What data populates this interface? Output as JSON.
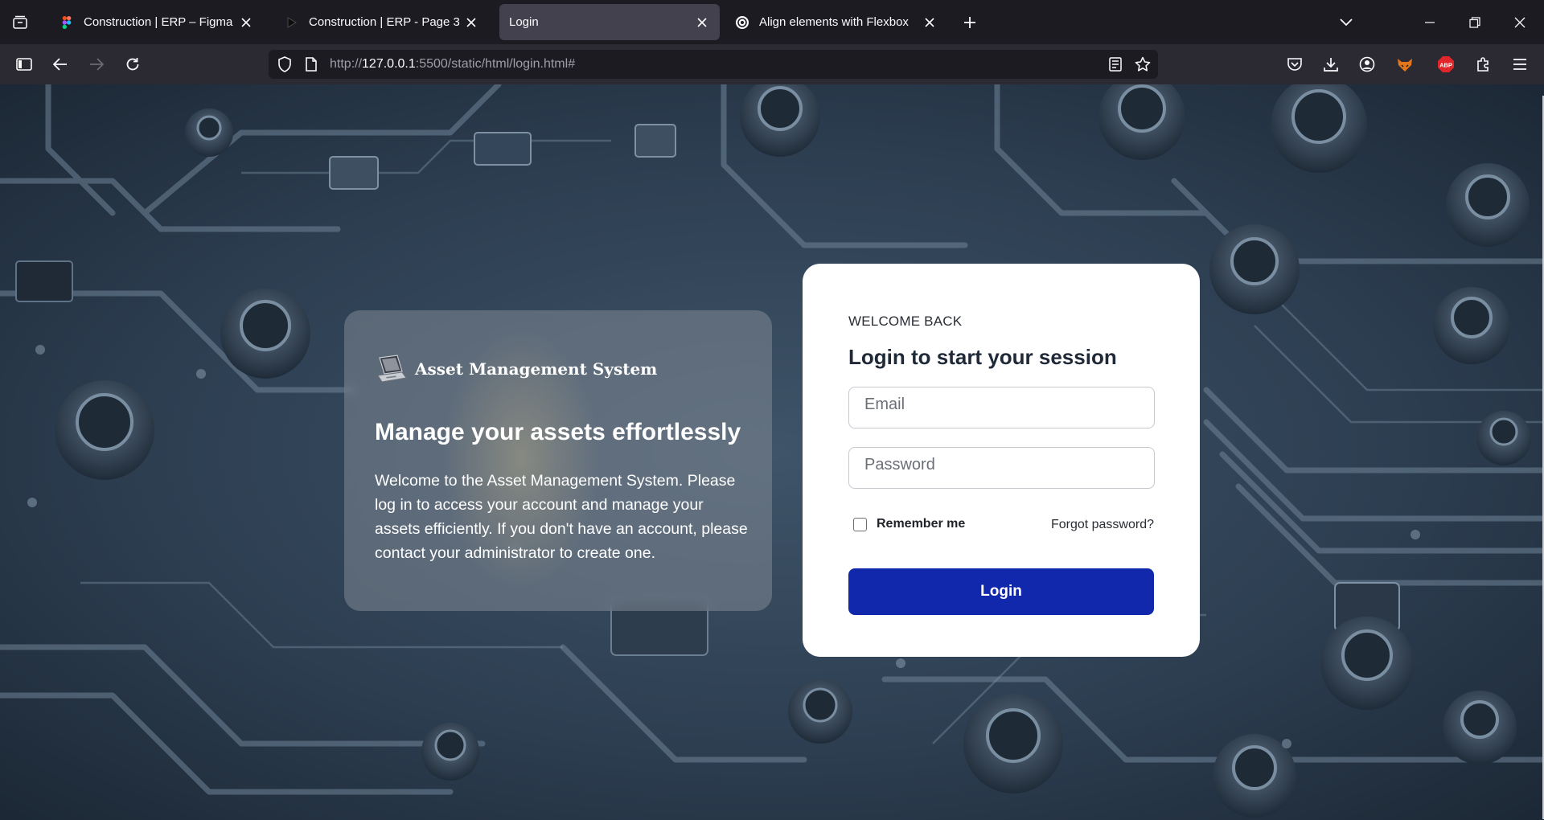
{
  "browser": {
    "tabs": [
      {
        "title": "Construction | ERP – Figma",
        "active": false,
        "favicon": "figma-icon"
      },
      {
        "title": "Construction | ERP - Page 3",
        "active": false,
        "favicon": "play-icon"
      },
      {
        "title": "Login",
        "active": true,
        "favicon": ""
      },
      {
        "title": "Align elements with Flexbox",
        "active": false,
        "favicon": "openai-icon"
      }
    ],
    "url": {
      "scheme": "http://",
      "host": "127.0.0.1",
      "rest": ":5500/static/html/login.html#"
    },
    "toolbar_icons": [
      "sidebar-icon",
      "back-icon",
      "forward-icon",
      "reload-icon",
      "shield-icon",
      "page-icon",
      "reader-view-icon",
      "bookmark-star-icon",
      "pocket-icon",
      "download-icon",
      "account-icon",
      "extension-fox-icon",
      "adblock-icon",
      "extensions-icon",
      "menu-icon"
    ],
    "adblock_label": "ABP"
  },
  "info": {
    "brand_name": "Asset Management System",
    "heading": "Manage your assets effortlessly",
    "body": "Welcome to the Asset Management System. Please log in to access your account and manage your assets efficiently. If you don't have an account, please contact your administrator to create one."
  },
  "login": {
    "eyebrow": "WELCOME BACK",
    "title": "Login to start your session",
    "email_placeholder": "Email",
    "password_placeholder": "Password",
    "remember_label": "Remember me",
    "forgot_label": "Forgot password?",
    "submit_label": "Login"
  },
  "colors": {
    "primary_button": "#1128ad",
    "browser_dark": "#1c1b22",
    "active_tab": "#42414d"
  }
}
